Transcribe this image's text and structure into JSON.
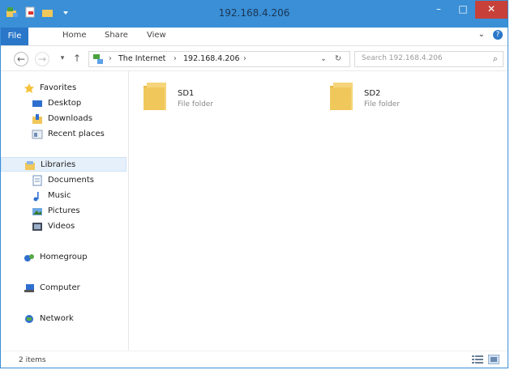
{
  "window": {
    "title": "192.168.4.206",
    "controls": {
      "minimize": "–",
      "maximize": "□",
      "close": "✕"
    }
  },
  "ribbon": {
    "tabs": [
      {
        "label": "File"
      },
      {
        "label": "Home"
      },
      {
        "label": "Share"
      },
      {
        "label": "View"
      }
    ],
    "expand_glyph": "⌄",
    "help_glyph": "?"
  },
  "address": {
    "back_glyph": "←",
    "forward_glyph": "→",
    "recent_glyph": "▾",
    "up_glyph": "↑",
    "crumbs": [
      {
        "label": "The Internet"
      },
      {
        "label": "192.168.4.206"
      }
    ],
    "separator": "›",
    "dropdown_glyph": "⌄",
    "refresh_glyph": "↻",
    "search_placeholder": "Search 192.168.4.206",
    "search_glyph": "⌕"
  },
  "nav": {
    "favorites": {
      "label": "Favorites",
      "items": [
        {
          "label": "Desktop"
        },
        {
          "label": "Downloads"
        },
        {
          "label": "Recent places"
        }
      ]
    },
    "libraries": {
      "label": "Libraries",
      "items": [
        {
          "label": "Documents"
        },
        {
          "label": "Music"
        },
        {
          "label": "Pictures"
        },
        {
          "label": "Videos"
        }
      ]
    },
    "homegroup": {
      "label": "Homegroup"
    },
    "computer": {
      "label": "Computer"
    },
    "network": {
      "label": "Network"
    }
  },
  "content": {
    "items": [
      {
        "name": "SD1",
        "type": "File folder"
      },
      {
        "name": "SD2",
        "type": "File folder"
      }
    ]
  },
  "status": {
    "count_text": "2 items"
  },
  "colors": {
    "titlebar": "#3a8fd6",
    "file_tab": "#2a77c9",
    "close": "#c7413a",
    "folder": "#f0c75a"
  }
}
